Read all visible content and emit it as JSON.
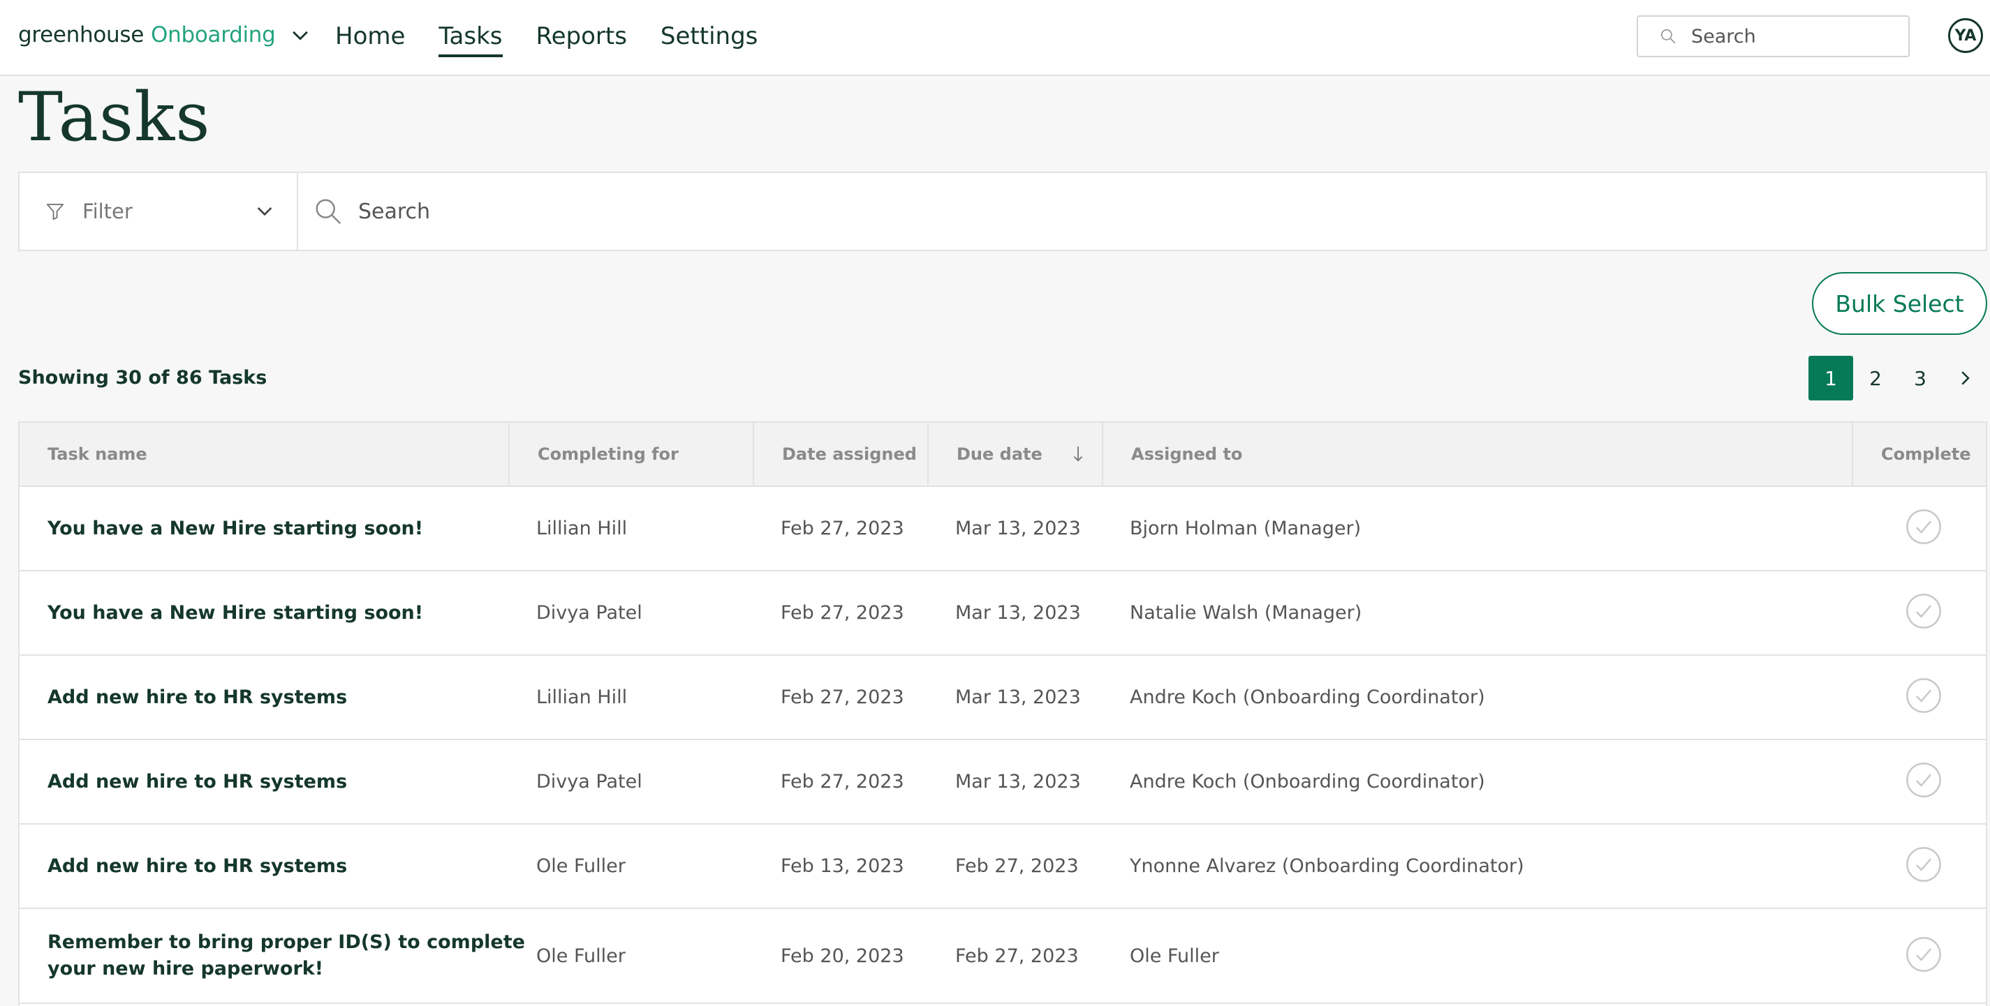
{
  "brand": {
    "name_part1": "greenhouse",
    "name_part2": "Onboarding"
  },
  "nav": {
    "home": "Home",
    "tasks": "Tasks",
    "reports": "Reports",
    "settings": "Settings"
  },
  "top_search": {
    "placeholder": "Search"
  },
  "user": {
    "initials": "YA"
  },
  "page": {
    "title": "Tasks"
  },
  "filter": {
    "label": "Filter"
  },
  "search": {
    "placeholder": "Search"
  },
  "bulk_select_label": "Bulk Select",
  "summary": "Showing 30 of 86 Tasks",
  "pagination": {
    "pages": [
      "1",
      "2",
      "3"
    ],
    "current": "1"
  },
  "table": {
    "columns": {
      "task_name": "Task name",
      "completing_for": "Completing for",
      "date_assigned": "Date assigned",
      "due_date": "Due date",
      "assigned_to": "Assigned to",
      "complete": "Complete"
    },
    "rows": [
      {
        "task": "You have a New Hire starting soon!",
        "for": "Lillian Hill",
        "assigned": "Feb 27, 2023",
        "due": "Mar 13, 2023",
        "to": "Bjorn Holman (Manager)"
      },
      {
        "task": "You have a New Hire starting soon!",
        "for": "Divya Patel",
        "assigned": "Feb 27, 2023",
        "due": "Mar 13, 2023",
        "to": "Natalie Walsh (Manager)"
      },
      {
        "task": "Add new hire to HR systems",
        "for": "Lillian Hill",
        "assigned": "Feb 27, 2023",
        "due": "Mar 13, 2023",
        "to": "Andre Koch (Onboarding Coordinator)"
      },
      {
        "task": "Add new hire to HR systems",
        "for": "Divya Patel",
        "assigned": "Feb 27, 2023",
        "due": "Mar 13, 2023",
        "to": "Andre Koch (Onboarding Coordinator)"
      },
      {
        "task": "Add new hire to HR systems",
        "for": "Ole Fuller",
        "assigned": "Feb 13, 2023",
        "due": "Feb 27, 2023",
        "to": "Ynonne Alvarez (Onboarding Coordinator)"
      },
      {
        "task_line1": "Remember to bring proper ID(S) to complete",
        "task_line2": "your new hire paperwork!",
        "for": "Ole Fuller",
        "assigned": "Feb 20, 2023",
        "due": "Feb 27, 2023",
        "to": "Ole Fuller"
      }
    ]
  },
  "colors": {
    "brand_dark": "#15372c",
    "brand_green": "#24a47f",
    "accent": "#067a57"
  }
}
